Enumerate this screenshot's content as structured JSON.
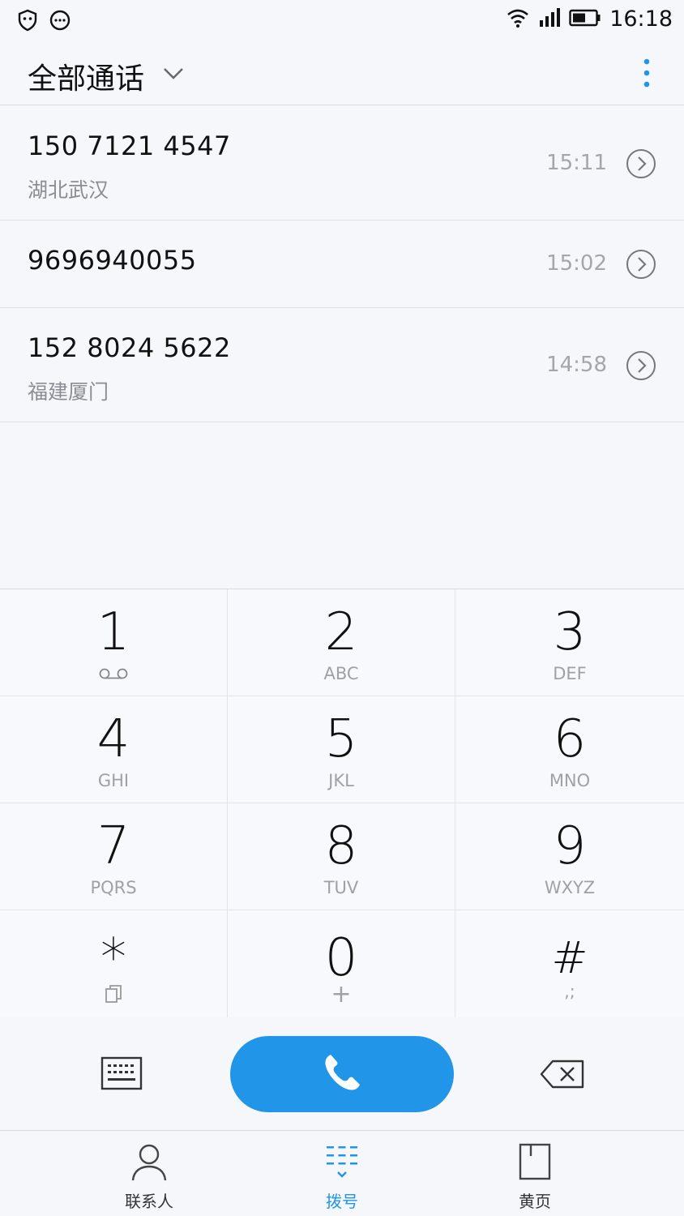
{
  "status_bar": {
    "time": "16:18"
  },
  "header": {
    "title": "全部通话"
  },
  "calls": [
    {
      "number": "150 7121 4547",
      "location": "湖北武汉",
      "time": "15:11"
    },
    {
      "number": "9696940055",
      "location": "",
      "time": "15:02"
    },
    {
      "number": "152 8024 5622",
      "location": "福建厦门",
      "time": "14:58"
    }
  ],
  "keypad": [
    {
      "digit": "1",
      "letters": ""
    },
    {
      "digit": "2",
      "letters": "ABC"
    },
    {
      "digit": "3",
      "letters": "DEF"
    },
    {
      "digit": "4",
      "letters": "GHI"
    },
    {
      "digit": "5",
      "letters": "JKL"
    },
    {
      "digit": "6",
      "letters": "MNO"
    },
    {
      "digit": "7",
      "letters": "PQRS"
    },
    {
      "digit": "8",
      "letters": "TUV"
    },
    {
      "digit": "9",
      "letters": "WXYZ"
    },
    {
      "digit": "*",
      "letters": ""
    },
    {
      "digit": "0",
      "letters": "+"
    },
    {
      "digit": "#",
      "letters": ",;"
    }
  ],
  "nav": {
    "contacts": "联系人",
    "dial": "拨号",
    "yellow_pages": "黄页"
  },
  "colors": {
    "accent": "#2196e8",
    "background": "#f5f7fb"
  },
  "icons": {
    "status_left": [
      "shield-icon",
      "message-icon"
    ],
    "status_right": [
      "wifi-icon",
      "signal-icon",
      "battery-icon"
    ]
  }
}
